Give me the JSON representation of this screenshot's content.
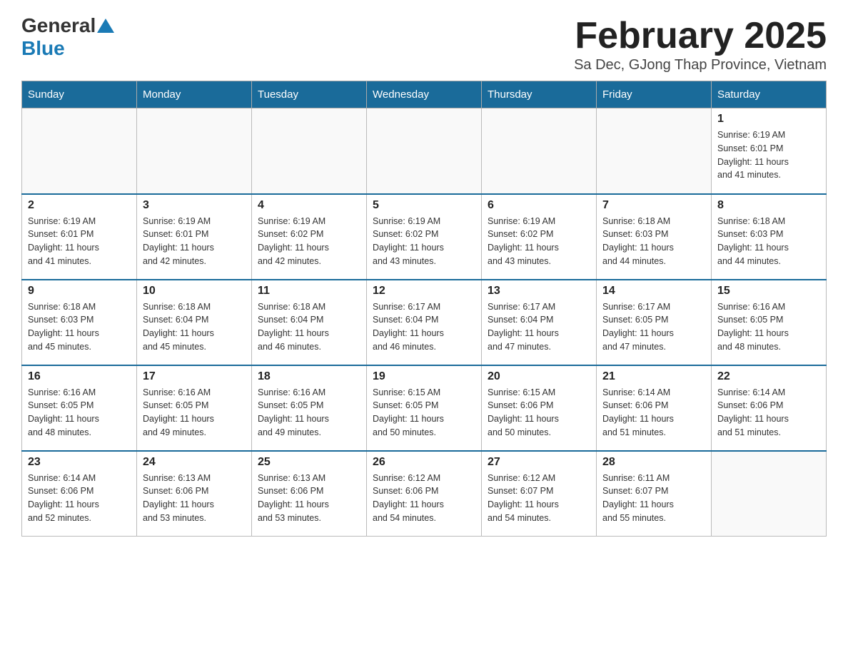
{
  "header": {
    "logo_general": "General",
    "logo_blue": "Blue",
    "title": "February 2025",
    "subtitle": "Sa Dec, GJong Thap Province, Vietnam"
  },
  "days_of_week": [
    "Sunday",
    "Monday",
    "Tuesday",
    "Wednesday",
    "Thursday",
    "Friday",
    "Saturday"
  ],
  "weeks": [
    {
      "days": [
        {
          "num": "",
          "info": ""
        },
        {
          "num": "",
          "info": ""
        },
        {
          "num": "",
          "info": ""
        },
        {
          "num": "",
          "info": ""
        },
        {
          "num": "",
          "info": ""
        },
        {
          "num": "",
          "info": ""
        },
        {
          "num": "1",
          "info": "Sunrise: 6:19 AM\nSunset: 6:01 PM\nDaylight: 11 hours\nand 41 minutes."
        }
      ]
    },
    {
      "days": [
        {
          "num": "2",
          "info": "Sunrise: 6:19 AM\nSunset: 6:01 PM\nDaylight: 11 hours\nand 41 minutes."
        },
        {
          "num": "3",
          "info": "Sunrise: 6:19 AM\nSunset: 6:01 PM\nDaylight: 11 hours\nand 42 minutes."
        },
        {
          "num": "4",
          "info": "Sunrise: 6:19 AM\nSunset: 6:02 PM\nDaylight: 11 hours\nand 42 minutes."
        },
        {
          "num": "5",
          "info": "Sunrise: 6:19 AM\nSunset: 6:02 PM\nDaylight: 11 hours\nand 43 minutes."
        },
        {
          "num": "6",
          "info": "Sunrise: 6:19 AM\nSunset: 6:02 PM\nDaylight: 11 hours\nand 43 minutes."
        },
        {
          "num": "7",
          "info": "Sunrise: 6:18 AM\nSunset: 6:03 PM\nDaylight: 11 hours\nand 44 minutes."
        },
        {
          "num": "8",
          "info": "Sunrise: 6:18 AM\nSunset: 6:03 PM\nDaylight: 11 hours\nand 44 minutes."
        }
      ]
    },
    {
      "days": [
        {
          "num": "9",
          "info": "Sunrise: 6:18 AM\nSunset: 6:03 PM\nDaylight: 11 hours\nand 45 minutes."
        },
        {
          "num": "10",
          "info": "Sunrise: 6:18 AM\nSunset: 6:04 PM\nDaylight: 11 hours\nand 45 minutes."
        },
        {
          "num": "11",
          "info": "Sunrise: 6:18 AM\nSunset: 6:04 PM\nDaylight: 11 hours\nand 46 minutes."
        },
        {
          "num": "12",
          "info": "Sunrise: 6:17 AM\nSunset: 6:04 PM\nDaylight: 11 hours\nand 46 minutes."
        },
        {
          "num": "13",
          "info": "Sunrise: 6:17 AM\nSunset: 6:04 PM\nDaylight: 11 hours\nand 47 minutes."
        },
        {
          "num": "14",
          "info": "Sunrise: 6:17 AM\nSunset: 6:05 PM\nDaylight: 11 hours\nand 47 minutes."
        },
        {
          "num": "15",
          "info": "Sunrise: 6:16 AM\nSunset: 6:05 PM\nDaylight: 11 hours\nand 48 minutes."
        }
      ]
    },
    {
      "days": [
        {
          "num": "16",
          "info": "Sunrise: 6:16 AM\nSunset: 6:05 PM\nDaylight: 11 hours\nand 48 minutes."
        },
        {
          "num": "17",
          "info": "Sunrise: 6:16 AM\nSunset: 6:05 PM\nDaylight: 11 hours\nand 49 minutes."
        },
        {
          "num": "18",
          "info": "Sunrise: 6:16 AM\nSunset: 6:05 PM\nDaylight: 11 hours\nand 49 minutes."
        },
        {
          "num": "19",
          "info": "Sunrise: 6:15 AM\nSunset: 6:05 PM\nDaylight: 11 hours\nand 50 minutes."
        },
        {
          "num": "20",
          "info": "Sunrise: 6:15 AM\nSunset: 6:06 PM\nDaylight: 11 hours\nand 50 minutes."
        },
        {
          "num": "21",
          "info": "Sunrise: 6:14 AM\nSunset: 6:06 PM\nDaylight: 11 hours\nand 51 minutes."
        },
        {
          "num": "22",
          "info": "Sunrise: 6:14 AM\nSunset: 6:06 PM\nDaylight: 11 hours\nand 51 minutes."
        }
      ]
    },
    {
      "days": [
        {
          "num": "23",
          "info": "Sunrise: 6:14 AM\nSunset: 6:06 PM\nDaylight: 11 hours\nand 52 minutes."
        },
        {
          "num": "24",
          "info": "Sunrise: 6:13 AM\nSunset: 6:06 PM\nDaylight: 11 hours\nand 53 minutes."
        },
        {
          "num": "25",
          "info": "Sunrise: 6:13 AM\nSunset: 6:06 PM\nDaylight: 11 hours\nand 53 minutes."
        },
        {
          "num": "26",
          "info": "Sunrise: 6:12 AM\nSunset: 6:06 PM\nDaylight: 11 hours\nand 54 minutes."
        },
        {
          "num": "27",
          "info": "Sunrise: 6:12 AM\nSunset: 6:07 PM\nDaylight: 11 hours\nand 54 minutes."
        },
        {
          "num": "28",
          "info": "Sunrise: 6:11 AM\nSunset: 6:07 PM\nDaylight: 11 hours\nand 55 minutes."
        },
        {
          "num": "",
          "info": ""
        }
      ]
    }
  ]
}
